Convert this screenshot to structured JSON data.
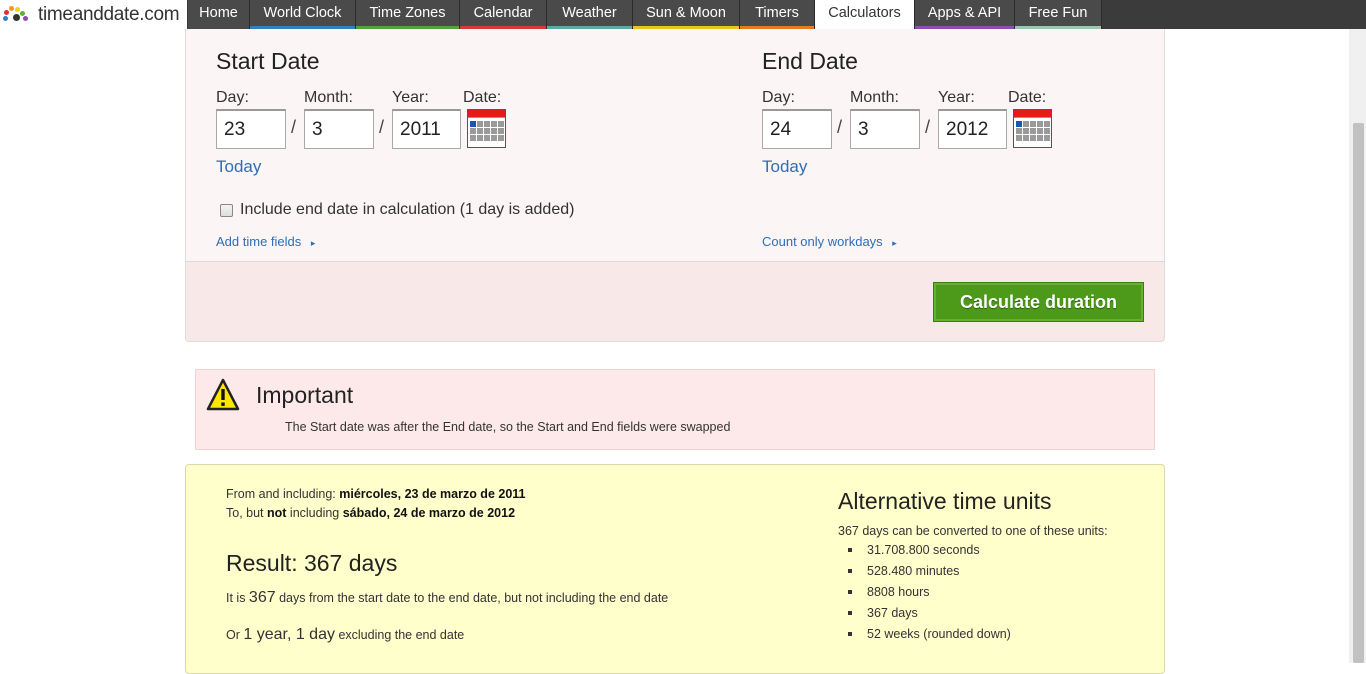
{
  "logo": {
    "text": "timeanddate.com"
  },
  "nav": [
    {
      "label": "Home",
      "color": "#4a4a4a",
      "width": 62
    },
    {
      "label": "World Clock",
      "color": "#2b83c6",
      "width": 106
    },
    {
      "label": "Time Zones",
      "color": "#56a03a",
      "width": 104
    },
    {
      "label": "Calendar",
      "color": "#d9383a",
      "width": 87
    },
    {
      "label": "Weather",
      "color": "#5aa8a8",
      "width": 86
    },
    {
      "label": "Sun & Moon",
      "color": "#e5c51f",
      "width": 107
    },
    {
      "label": "Timers",
      "color": "#e47c1e",
      "width": 75
    },
    {
      "label": "Calculators",
      "color": "#ffffff",
      "width": 100,
      "active": true
    },
    {
      "label": "Apps & API",
      "color": "#8e4db3",
      "width": 100
    },
    {
      "label": "Free Fun",
      "color": "#a0c4b0",
      "width": 87
    }
  ],
  "start": {
    "heading": "Start Date",
    "day_label": "Day:",
    "month_label": "Month:",
    "year_label": "Year:",
    "date_label": "Date:",
    "day": "23",
    "month": "3",
    "year": "2011",
    "today": "Today"
  },
  "end": {
    "heading": "End Date",
    "day_label": "Day:",
    "month_label": "Month:",
    "year_label": "Year:",
    "date_label": "Date:",
    "day": "24",
    "month": "3",
    "year": "2012",
    "today": "Today"
  },
  "slash": "/",
  "include_end": "Include end date in calculation (1 day is added)",
  "add_time_fields": "Add time fields",
  "count_workdays": "Count only workdays",
  "arrow": "▸",
  "calculate": "Calculate duration",
  "notice": {
    "title": "Important",
    "text": "The Start date was after the End date, so the Start and End fields were swapped"
  },
  "result": {
    "from_prefix": "From and including: ",
    "from_date": "miércoles, 23 de marzo de 2011",
    "to_prefix": "To, but ",
    "to_not": "not",
    "to_mid": " including ",
    "to_date": "sábado, 24 de marzo de 2012",
    "title": "Result: 367 days",
    "line1_pre": "It is ",
    "line1_num": "367",
    "line1_post": " days from the start date to the end date, but not including the end date",
    "line2_pre": "Or ",
    "line2_big": "1 year, 1 day",
    "line2_post": " excluding the end date"
  },
  "alt": {
    "title": "Alternative time units",
    "intro": "367 days can be converted to one of these units:",
    "items": [
      "31.708.800 seconds",
      "528.480 minutes",
      "8808 hours",
      "367 days",
      "52 weeks (rounded down)"
    ]
  }
}
